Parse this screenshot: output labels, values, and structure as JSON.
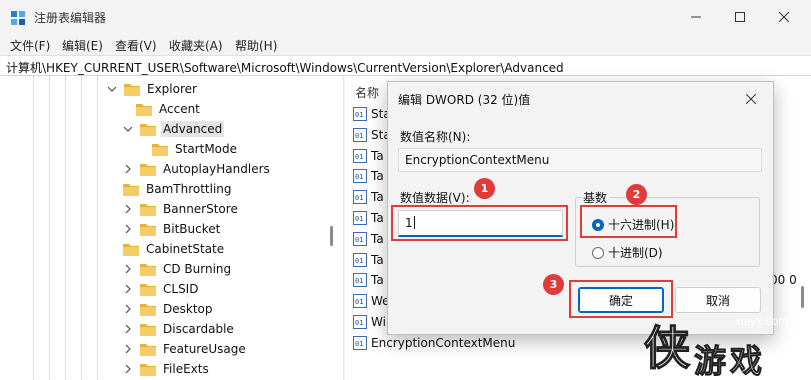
{
  "window": {
    "title": "注册表编辑器",
    "icons": {
      "app": "registry-editor-icon",
      "min": "minimize-icon",
      "max": "maximize-icon",
      "close": "close-icon"
    }
  },
  "menu": [
    "文件(F)",
    "编辑(E)",
    "查看(V)",
    "收藏夹(A)",
    "帮助(H)"
  ],
  "address": "计算机\\HKEY_CURRENT_USER\\Software\\Microsoft\\Windows\\CurrentVersion\\Explorer\\Advanced",
  "tree": [
    {
      "label": "Explorer",
      "chevron": "down"
    },
    {
      "label": "Accent",
      "chevron": "none"
    },
    {
      "label": "Advanced",
      "chevron": "down",
      "selected": true
    },
    {
      "label": "StartMode",
      "chevron": "none"
    },
    {
      "label": "AutoplayHandlers",
      "chevron": "right"
    },
    {
      "label": "BamThrottling",
      "chevron": "none"
    },
    {
      "label": "BannerStore",
      "chevron": "right"
    },
    {
      "label": "BitBucket",
      "chevron": "right"
    },
    {
      "label": "CabinetState",
      "chevron": "none"
    },
    {
      "label": "CD Burning",
      "chevron": "right"
    },
    {
      "label": "CLSID",
      "chevron": "right"
    },
    {
      "label": "Desktop",
      "chevron": "right"
    },
    {
      "label": "Discardable",
      "chevron": "right"
    },
    {
      "label": "FeatureUsage",
      "chevron": "right"
    },
    {
      "label": "FileExts",
      "chevron": "right"
    }
  ],
  "list": {
    "header": "名称",
    "rows": [
      "Sta",
      "Sta",
      "Ta",
      "Ta",
      "Ta",
      "Ta",
      "Ta",
      "Ta",
      "Ta",
      "We",
      "Wi",
      "EncryptionContextMenu"
    ],
    "partial_value": "00 0"
  },
  "dialog": {
    "title": "编辑 DWORD (32 位)值",
    "name_label": "数值名称(N):",
    "name_value": "EncryptionContextMenu",
    "data_label": "数值数据(V):",
    "data_value": "1",
    "base_label": "基数",
    "radio_hex": "十六进制(H)",
    "radio_dec": "十进制(D)",
    "selected_base": "hex",
    "ok": "确定",
    "cancel": "取消"
  },
  "badges": [
    "1",
    "2",
    "3"
  ],
  "watermark": {
    "url": "xiayx.com",
    "logo_text": "侠游戏"
  },
  "colors": {
    "accent": "#0067c0",
    "annotation": "#e03c3c",
    "folder": "#f2c55c"
  }
}
